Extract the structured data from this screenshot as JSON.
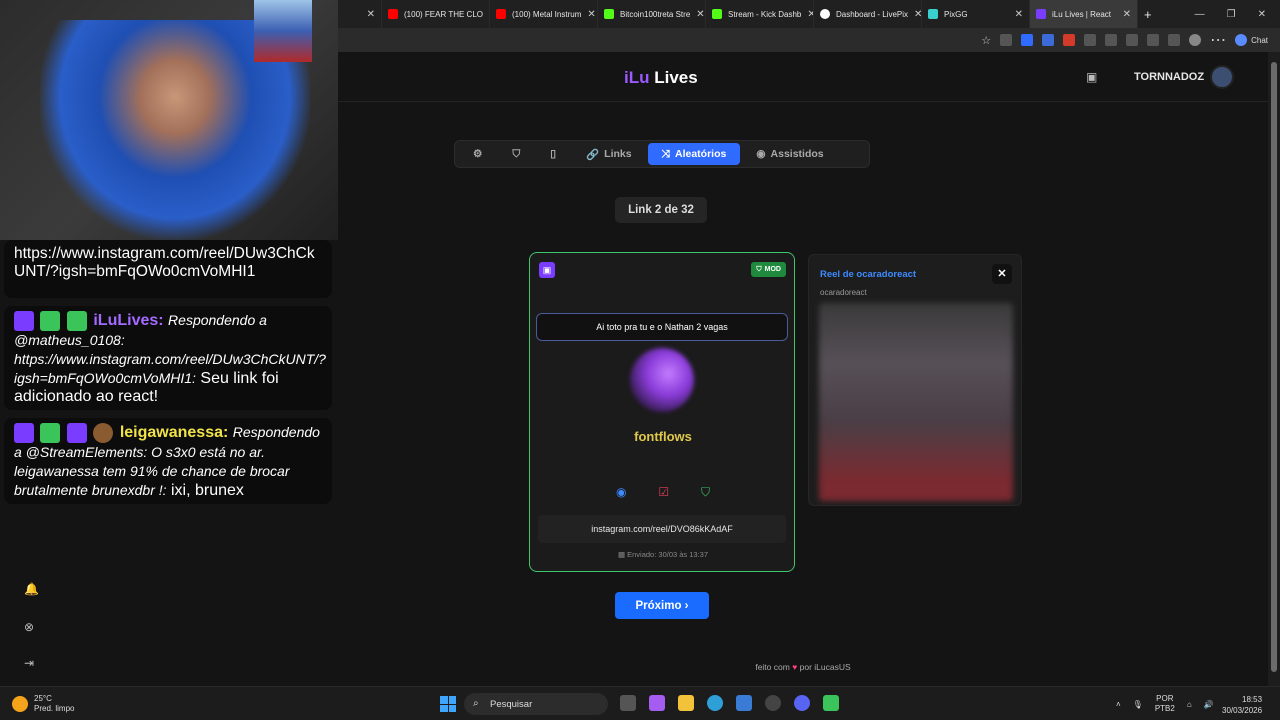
{
  "browser": {
    "tabs": [
      {
        "title": "(100) FEAR THE CLO",
        "color": "#ff0000"
      },
      {
        "title": "(100) Metal Instrum",
        "color": "#ff0000"
      },
      {
        "title": "Bitcoin100treta Stre",
        "color": "#53fc18"
      },
      {
        "title": "Stream - Kick Dashb",
        "color": "#53fc18"
      },
      {
        "title": "Dashboard - LivePix",
        "color": "#ffffff"
      },
      {
        "title": "PixGG",
        "color": "#3ad0d0"
      },
      {
        "title": "iLu Lives | React",
        "color": "#7a3cff"
      }
    ],
    "chat_label": "Chat"
  },
  "app": {
    "logo_prefix": "iLu",
    "logo_suffix": " Lives",
    "username": "TORNNADOZ",
    "tabs": [
      {
        "label": "",
        "icon": "gear-icon",
        "glyph": "⚙"
      },
      {
        "label": "",
        "icon": "shield-icon",
        "glyph": "⛉"
      },
      {
        "label": "",
        "icon": "tablet-icon",
        "glyph": "▯"
      },
      {
        "label": "Links",
        "icon": "link-icon",
        "glyph": "🔗"
      },
      {
        "label": "Aleatórios",
        "icon": "shuffle-icon",
        "glyph": "⤨"
      },
      {
        "label": "Assistidos",
        "icon": "eye-icon",
        "glyph": "◉"
      }
    ],
    "counter": "Link 2 de 32",
    "card": {
      "mod_label": "MOD",
      "message": "Ai toto pra tu e o Nathan 2 vagas",
      "username": "fontflows",
      "link": "instagram.com/reel/DVO86kKAdAF",
      "sent": "Enviado: 30/03 às 13:37"
    },
    "reel": {
      "title": "Reel de ocaradoreact",
      "subtitle": "ocaradoreact"
    },
    "next_label": "Próximo ›",
    "footer_prefix": "feito com",
    "footer_suffix": "por iLucasUS"
  },
  "overlay": {
    "chat1": "https://www.instagram.com/reel/DUw3ChCkUNT/?igsh=bmFqOWo0cmVoMHI1",
    "chat2_name": "iLuLives:",
    "chat2_em": "Respondendo a @matheus_0108: https://www.instagram.com/reel/DUw3ChCkUNT/?igsh=bmFqOWo0cmVoMHI1:",
    "chat2_text": "Seu link foi adicionado ao react!",
    "chat3_name": "leigawanessa:",
    "chat3_em": "Respondendo a @StreamElements: O s3x0 está no ar. leigawanessa tem 91% de chance de brocar brutalmente brunexdbr !:",
    "chat3_text": "ixi, brunex"
  },
  "taskbar": {
    "temp": "25°C",
    "weather": "Pred. limpo",
    "search": "Pesquisar",
    "lang1": "POR",
    "lang2": "PTB2",
    "time": "18:53",
    "date": "30/03/2026"
  }
}
